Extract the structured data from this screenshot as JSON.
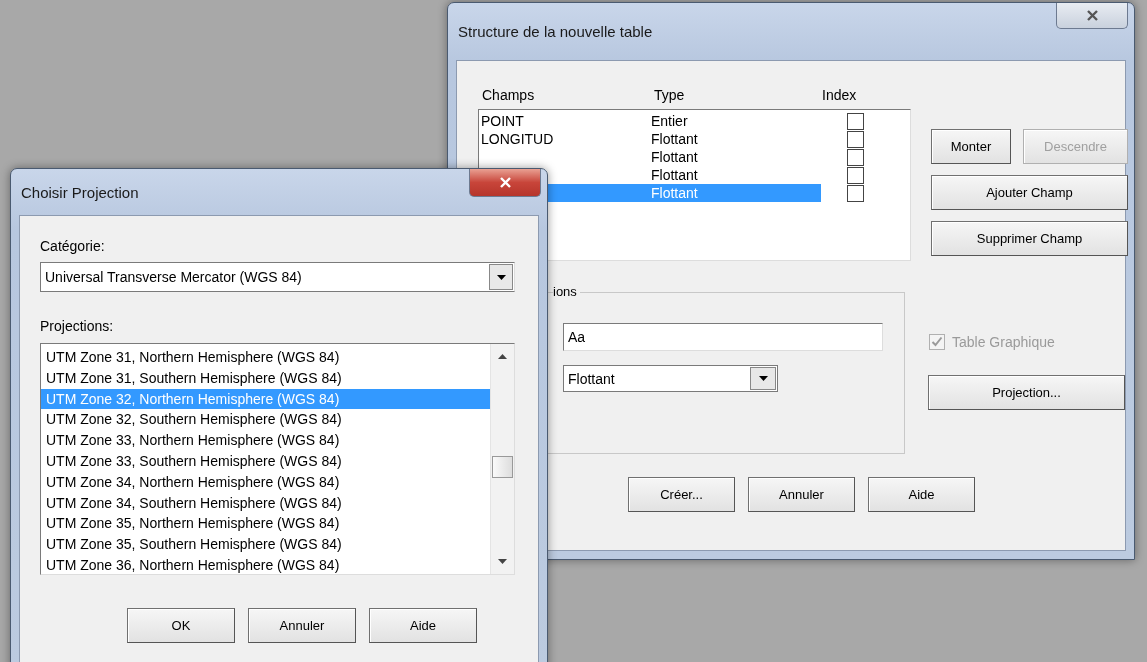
{
  "structure_dialog": {
    "title": "Structure de la nouvelle table",
    "columns": [
      "Champs",
      "Type",
      "Index"
    ],
    "fields": [
      {
        "name": "POINT",
        "type": "Entier",
        "indexed": false,
        "selected": false
      },
      {
        "name": "LONGITUD",
        "type": "Flottant",
        "indexed": false,
        "selected": false
      },
      {
        "type": "Flottant",
        "indexed": false,
        "selected": false
      },
      {
        "type": "Flottant",
        "indexed": false,
        "selected": false
      },
      {
        "type": "Flottant",
        "indexed": false,
        "selected": true
      }
    ],
    "side_buttons": [
      {
        "label": "Monter",
        "disabled": false
      },
      {
        "label": "Descendre",
        "disabled": true
      },
      {
        "label": "Ajouter Champ",
        "disabled": false
      },
      {
        "label": "Supprimer Champ",
        "disabled": false
      }
    ],
    "group_label": "ions",
    "name_value": "Aa",
    "type_value": "Flottant",
    "graphic_table": {
      "label": "Table Graphique",
      "checked": true,
      "disabled": true
    },
    "projection_button": "Projection...",
    "buttons": [
      "Créer...",
      "Annuler",
      "Aide"
    ]
  },
  "projection_dialog": {
    "title": "Choisir Projection",
    "category_label": "Catégorie:",
    "category_value": "Universal Transverse Mercator (WGS 84)",
    "projections_label": "Projections:",
    "projections": [
      {
        "label": "UTM Zone 31, Northern Hemisphere (WGS 84)",
        "selected": false
      },
      {
        "label": "UTM Zone 31, Southern Hemisphere (WGS 84)",
        "selected": false
      },
      {
        "label": "UTM Zone 32, Northern Hemisphere (WGS 84)",
        "selected": true
      },
      {
        "label": "UTM Zone 32, Southern Hemisphere (WGS 84)",
        "selected": false
      },
      {
        "label": "UTM Zone 33, Northern Hemisphere (WGS 84)",
        "selected": false
      },
      {
        "label": "UTM Zone 33, Southern Hemisphere (WGS 84)",
        "selected": false
      },
      {
        "label": "UTM Zone 34, Northern Hemisphere (WGS 84)",
        "selected": false
      },
      {
        "label": "UTM Zone 34, Southern Hemisphere (WGS 84)",
        "selected": false
      },
      {
        "label": "UTM Zone 35, Northern Hemisphere (WGS 84)",
        "selected": false
      },
      {
        "label": "UTM Zone 35, Southern Hemisphere (WGS 84)",
        "selected": false
      },
      {
        "label": "UTM Zone 36, Northern Hemisphere (WGS 84)",
        "selected": false
      }
    ],
    "buttons": [
      "OK",
      "Annuler",
      "Aide"
    ]
  }
}
